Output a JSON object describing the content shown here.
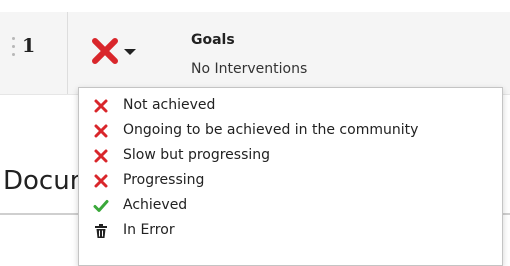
{
  "goal": {
    "row_number": "1",
    "title": "Goals",
    "subtitle": "No Interventions",
    "current_status_icon": "x-icon"
  },
  "background": {
    "heading": "Documentation"
  },
  "colors": {
    "cross": "#d9262b",
    "check": "#3aa83a",
    "trash": "#222222"
  },
  "menu": {
    "items": [
      {
        "label": "Not achieved",
        "icon": "x-icon"
      },
      {
        "label": "Ongoing to be achieved in the community",
        "icon": "x-icon"
      },
      {
        "label": "Slow but progressing",
        "icon": "x-icon"
      },
      {
        "label": "Progressing",
        "icon": "x-icon"
      },
      {
        "label": "Achieved",
        "icon": "check-icon"
      },
      {
        "label": "In Error",
        "icon": "trash-icon"
      }
    ]
  }
}
